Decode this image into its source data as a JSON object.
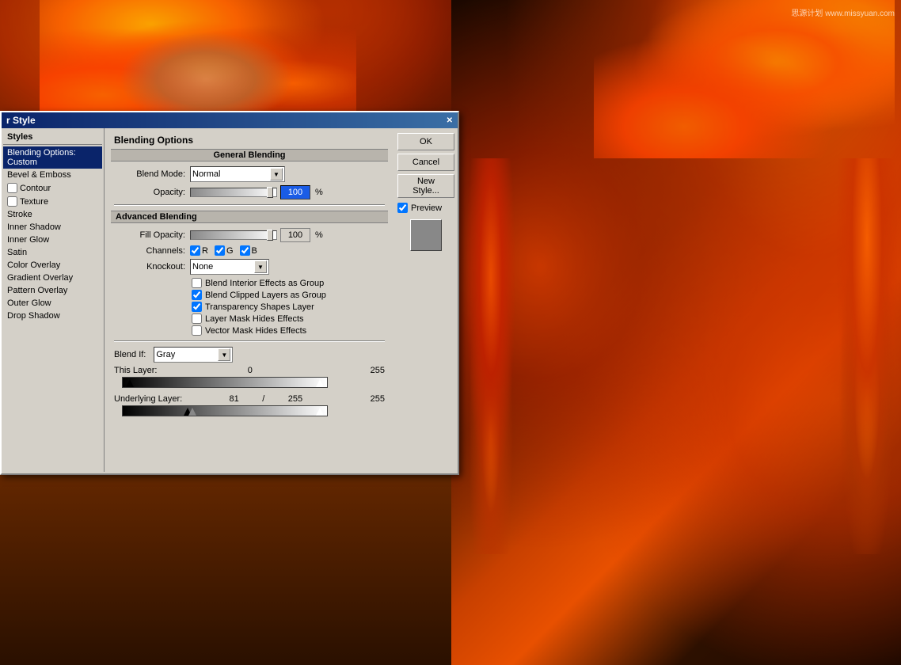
{
  "dialog": {
    "title": "r Style",
    "styles_panel": {
      "header": "Styles",
      "items": [
        {
          "label": "Blending Options: Custom",
          "active": true,
          "has_checkbox": false
        },
        {
          "label": "Bevel & Emboss",
          "active": false,
          "has_checkbox": false
        },
        {
          "label": "Contour",
          "active": false,
          "has_checkbox": true
        },
        {
          "label": "Texture",
          "active": false,
          "has_checkbox": true
        },
        {
          "label": "Stroke",
          "active": false,
          "has_checkbox": false
        },
        {
          "label": "Inner Shadow",
          "active": false,
          "has_checkbox": false
        },
        {
          "label": "Inner Glow",
          "active": false,
          "has_checkbox": false
        },
        {
          "label": "Satin",
          "active": false,
          "has_checkbox": false
        },
        {
          "label": "Color Overlay",
          "active": false,
          "has_checkbox": false
        },
        {
          "label": "Gradient Overlay",
          "active": false,
          "has_checkbox": false
        },
        {
          "label": "Pattern Overlay",
          "active": false,
          "has_checkbox": false
        },
        {
          "label": "Outer Glow",
          "active": false,
          "has_checkbox": false
        },
        {
          "label": "Drop Shadow",
          "active": false,
          "has_checkbox": false
        }
      ]
    },
    "blending_options": {
      "title": "Blending Options",
      "general_title": "General Blending",
      "blend_mode_label": "Blend Mode:",
      "blend_mode_value": "Normal",
      "opacity_label": "Opacity:",
      "opacity_value": "100",
      "opacity_percent": "%"
    },
    "advanced_blending": {
      "title": "Advanced Blending",
      "fill_opacity_label": "Fill Opacity:",
      "fill_opacity_value": "100",
      "channels_label": "Channels:",
      "channel_r": "R",
      "channel_g": "G",
      "channel_b": "B",
      "knockout_label": "Knockout:",
      "knockout_value": "None",
      "cb1": "Blend Interior Effects as Group",
      "cb2": "Blend Clipped Layers as Group",
      "cb3": "Transparency Shapes Layer",
      "cb4": "Layer Mask Hides Effects",
      "cb5": "Vector Mask Hides Effects"
    },
    "blend_if": {
      "label": "Blend If:",
      "value": "Gray",
      "this_layer_label": "This Layer:",
      "this_layer_min": "0",
      "this_layer_max": "255",
      "underlying_label": "Underlying Layer:",
      "underlying_min": "81",
      "underlying_sep": "/",
      "underlying_mid": "255",
      "underlying_max": "255"
    },
    "buttons": {
      "ok": "OK",
      "cancel": "Cancel",
      "new_style": "New Style...",
      "preview_label": "Preview"
    }
  },
  "watermark": "思源计划 www.missyuan.com"
}
